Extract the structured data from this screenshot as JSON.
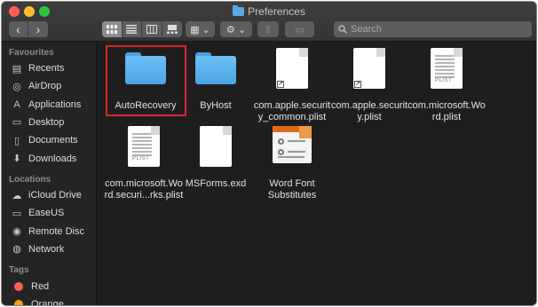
{
  "window": {
    "title": "Preferences"
  },
  "toolbar": {
    "back_glyph": "‹",
    "forward_glyph": "›",
    "view_icons": [
      "icon-view-icon",
      "list-view-icon",
      "column-view-icon",
      "gallery-view-icon"
    ],
    "group_glyph": "▦ ⌄",
    "action_glyph": "⚙ ⌄",
    "share_glyph": "⇪",
    "tags_glyph": "▭"
  },
  "search": {
    "placeholder": "Search"
  },
  "sidebar": {
    "favourites_heading": "Favourites",
    "favourites": [
      {
        "label": "Recents",
        "icon": "recents-icon",
        "glyph": "▤"
      },
      {
        "label": "AirDrop",
        "icon": "airdrop-icon",
        "glyph": "◎"
      },
      {
        "label": "Applications",
        "icon": "applications-icon",
        "glyph": "A"
      },
      {
        "label": "Desktop",
        "icon": "desktop-icon",
        "glyph": "▭"
      },
      {
        "label": "Documents",
        "icon": "documents-icon",
        "glyph": "▯"
      },
      {
        "label": "Downloads",
        "icon": "downloads-icon",
        "glyph": "⬇"
      }
    ],
    "locations_heading": "Locations",
    "locations": [
      {
        "label": "iCloud Drive",
        "icon": "icloud-icon",
        "glyph": "☁"
      },
      {
        "label": "EaseUS",
        "icon": "drive-icon",
        "glyph": "▭"
      },
      {
        "label": "Remote Disc",
        "icon": "disc-icon",
        "glyph": "◉"
      },
      {
        "label": "Network",
        "icon": "network-icon",
        "glyph": "◍"
      }
    ],
    "tags_heading": "Tags",
    "tags": [
      {
        "label": "Red",
        "color": "#ff5f57"
      },
      {
        "label": "Orange",
        "color": "#ff9f0a"
      }
    ]
  },
  "files": [
    {
      "name": "AutoRecovery",
      "kind": "folder"
    },
    {
      "name": "ByHost",
      "kind": "folder"
    },
    {
      "name": "com.apple.securit y_common.plist",
      "kind": "alias-doc"
    },
    {
      "name": "com.apple.securit y.plist",
      "kind": "alias-doc"
    },
    {
      "name": "com.microsoft.Wo rd.plist",
      "kind": "plist"
    },
    {
      "name": "com.microsoft.Wo rd.securi...rks.plist",
      "kind": "plist"
    },
    {
      "name": "MSForms.exd",
      "kind": "doc"
    },
    {
      "name": "Word Font Substitutes",
      "kind": "package"
    }
  ],
  "plist_badge": "PLIST",
  "alias_glyph": "↗",
  "selected_file": "AutoRecovery",
  "highlight_color": "#d9262b"
}
